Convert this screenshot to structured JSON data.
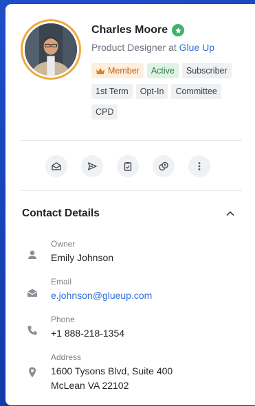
{
  "profile": {
    "name": "Charles Moore",
    "role_prefix": "Product Designer at",
    "company": "Glue Up",
    "tags": [
      "Member",
      "Active",
      "Subscriber",
      "1st Term",
      "Opt-In",
      "Committee",
      "CPD"
    ]
  },
  "actions": [
    {
      "name": "envelope-open-icon"
    },
    {
      "name": "send-icon"
    },
    {
      "name": "clipboard-check-icon"
    },
    {
      "name": "coins-icon"
    },
    {
      "name": "more-vertical-icon"
    }
  ],
  "contact": {
    "title": "Contact Details",
    "owner_label": "Owner",
    "owner_value": "Emily Johnson",
    "email_label": "Email",
    "email_value": "e.johnson@glueup.com",
    "phone_label": "Phone",
    "phone_value": "+1 888-218-1354",
    "address_label": "Address",
    "address_line1": "1600 Tysons Blvd, Suite 400",
    "address_line2": "McLean VA 22102"
  },
  "colors": {
    "background": "#1d4fc9",
    "accent_orange": "#f0a93a",
    "link_blue": "#2f6fdb",
    "active_green": "#2b7a42"
  }
}
